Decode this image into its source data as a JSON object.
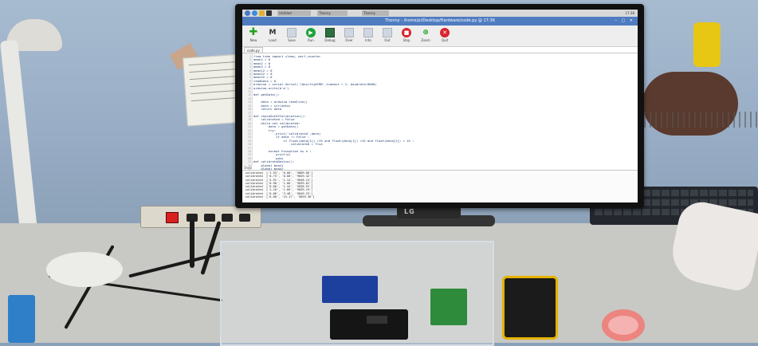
{
  "taskbar": {
    "items": [
      "Untitled",
      "Thonny",
      "Thonny"
    ],
    "tray": "17:36"
  },
  "window": {
    "title": "Thonny - /home/pi/Desktop/Hardware/code.py @ 17:36",
    "controls": "– ▢ ✕"
  },
  "toolbar": {
    "buttons": [
      {
        "label": "New",
        "icon": "plus-icon",
        "color": "#21a121"
      },
      {
        "label": "Load",
        "icon": "folder-m-icon",
        "color": "#333333"
      },
      {
        "label": "Save",
        "icon": "save-icon",
        "color": "#9aa4b0"
      },
      {
        "label": "Run",
        "icon": "run-icon",
        "color": "#1fa33a"
      },
      {
        "label": "Debug",
        "icon": "debug-icon",
        "color": "#2f6f3f"
      },
      {
        "label": "Over",
        "icon": "step-over-icon",
        "color": "#9aa4b0"
      },
      {
        "label": "Into",
        "icon": "step-into-icon",
        "color": "#9aa4b0"
      },
      {
        "label": "Out",
        "icon": "step-out-icon",
        "color": "#9aa4b0"
      },
      {
        "label": "Stop",
        "icon": "stop-icon",
        "color": "#d9232e"
      },
      {
        "label": "Zoom",
        "icon": "zoom-icon",
        "color": "#21a121"
      },
      {
        "label": "Quit",
        "icon": "quit-icon",
        "color": "#d9232e"
      }
    ]
  },
  "editor": {
    "tab": "code.py",
    "lines": [
      "from time import sleep, perf_counter",
      "mean1 = 0",
      "mean2 = 0",
      "mean3 = 0",
      "mean12 = 0",
      "mean22 = 0",
      "mean32 = 0",
      "readData = 0",
      "arduino = serial.Serial('/dev/ttyACM0',timeout = 2, baudrate=9600)",
      "arduino.write(b'm')",
      "",
      "def getData():",
      "",
      "    data = arduino.readline()",
      "    data = str(data)",
      "    return data",
      "",
      "def checkOutOfCalibration():",
      "    calibrated = False",
      "    while not calibrated:",
      "        data = getData()",
      "        try:",
      "            print('calibrated',data)",
      "            if data != False :",
      "                if float(data[1]) >15 and float(data[1]) <15 and float(data[2]) < 15 :",
      "                    calibrated = True",
      "",
      "        except Exception as e :",
      "            print(e)",
      "            pass",
      "def calibrateDevice():",
      "    global mean1",
      "    global mean2",
      "    global mean3"
    ]
  },
  "shell": {
    "label": "Shell",
    "lines": [
      "calibrated  ['1.93', '0.00', '9889.06']",
      "calibrated  ['0.73', '0.00', '9849.42']",
      "calibrated  ['4.91', '1.14', '9848.14']",
      "calibrated  ['0.96', '1.06', '9839.81']",
      "calibrated  ['0.06', '1.44', '9838.91']",
      "calibrated  ['1.18', '1.66', '9839.19']",
      "calibrated  ['0.86', '3.48', '9849.23']",
      "calibrated  ['6.00', '15.17', '9859.36']"
    ]
  },
  "monitor_brand": "LG"
}
